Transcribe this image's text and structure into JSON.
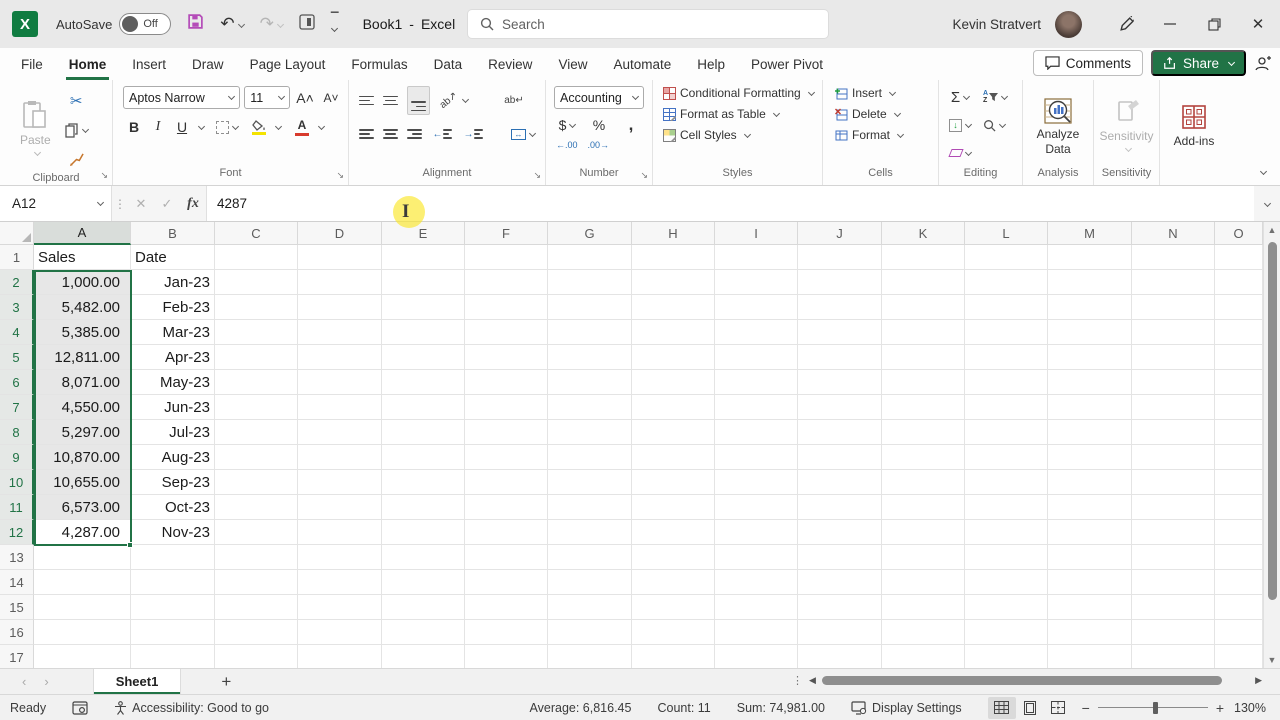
{
  "titlebar": {
    "autosave_label": "AutoSave",
    "autosave_state": "Off",
    "doc_title": "Book1",
    "title_separator": "-",
    "app_name": "Excel",
    "search_placeholder": "Search",
    "user_name": "Kevin Stratvert"
  },
  "tabs": {
    "items": [
      "File",
      "Home",
      "Insert",
      "Draw",
      "Page Layout",
      "Formulas",
      "Data",
      "Review",
      "View",
      "Automate",
      "Help",
      "Power Pivot"
    ],
    "active": "Home",
    "comments_label": "Comments",
    "share_label": "Share"
  },
  "ribbon": {
    "clipboard": {
      "label": "Clipboard",
      "paste": "Paste"
    },
    "font": {
      "label": "Font",
      "font_name": "Aptos Narrow",
      "font_size": "11",
      "bold": "B",
      "italic": "I",
      "underline": "U",
      "color_letter": "A",
      "grow": "A˄",
      "shrink": "A˅"
    },
    "alignment": {
      "label": "Alignment",
      "wrap_abbr": "ab"
    },
    "number": {
      "label": "Number",
      "format": "Accounting",
      "currency": "$",
      "percent": "%",
      "comma": ",",
      "inc_decimal": "←.00",
      "dec_decimal": ".00→"
    },
    "styles": {
      "label": "Styles",
      "conditional": "Conditional Formatting",
      "format_table": "Format as Table",
      "cell_styles": "Cell Styles"
    },
    "cells": {
      "label": "Cells",
      "insert": "Insert",
      "delete": "Delete",
      "format": "Format"
    },
    "editing": {
      "label": "Editing",
      "autosum_glyph": "Σ",
      "sort_a": "A",
      "sort_z": "Z"
    },
    "analysis": {
      "label": "Analysis",
      "button_line1": "Analyze",
      "button_line2": "Data"
    },
    "sensitivity": {
      "label": "Sensitivity",
      "button": "Sensitivity"
    },
    "addins": {
      "label": "Add-ins",
      "button": "Add-ins"
    }
  },
  "formula_bar": {
    "cell_reference": "A12",
    "formula": "4287",
    "fx_label": "fx"
  },
  "grid": {
    "column_headers": [
      "A",
      "B",
      "C",
      "D",
      "E",
      "F",
      "G",
      "H",
      "I",
      "J",
      "K",
      "L",
      "M",
      "N",
      "O"
    ],
    "visible_rows": 17,
    "selection": {
      "range": "A2:A12",
      "active_cell": "A12",
      "selected_column": "A",
      "selected_rows": [
        2,
        12
      ]
    }
  },
  "sheet_data": {
    "headers": [
      "Sales",
      "Date"
    ],
    "rows": [
      [
        "1,000.00",
        "Jan-23"
      ],
      [
        "5,482.00",
        "Feb-23"
      ],
      [
        "5,385.00",
        "Mar-23"
      ],
      [
        "12,811.00",
        "Apr-23"
      ],
      [
        "8,071.00",
        "May-23"
      ],
      [
        "4,550.00",
        "Jun-23"
      ],
      [
        "5,297.00",
        "Jul-23"
      ],
      [
        "10,870.00",
        "Aug-23"
      ],
      [
        "10,655.00",
        "Sep-23"
      ],
      [
        "6,573.00",
        "Oct-23"
      ],
      [
        "4,287.00",
        "Nov-23"
      ]
    ]
  },
  "sheet_tabs": {
    "active": "Sheet1",
    "add_label": "+"
  },
  "status_bar": {
    "mode": "Ready",
    "accessibility": "Accessibility: Good to go",
    "average": "Average: 6,816.45",
    "count": "Count: 11",
    "sum": "Sum: 74,981.00",
    "display_settings": "Display Settings",
    "zoom_level": "130%"
  },
  "colors": {
    "excel_green": "#217346",
    "logo_green": "#107c41",
    "save_purple": "#b44cb8",
    "fill_yellow": "#f4e300",
    "font_red": "#d83b2d",
    "addins_red": "#b3443e"
  }
}
